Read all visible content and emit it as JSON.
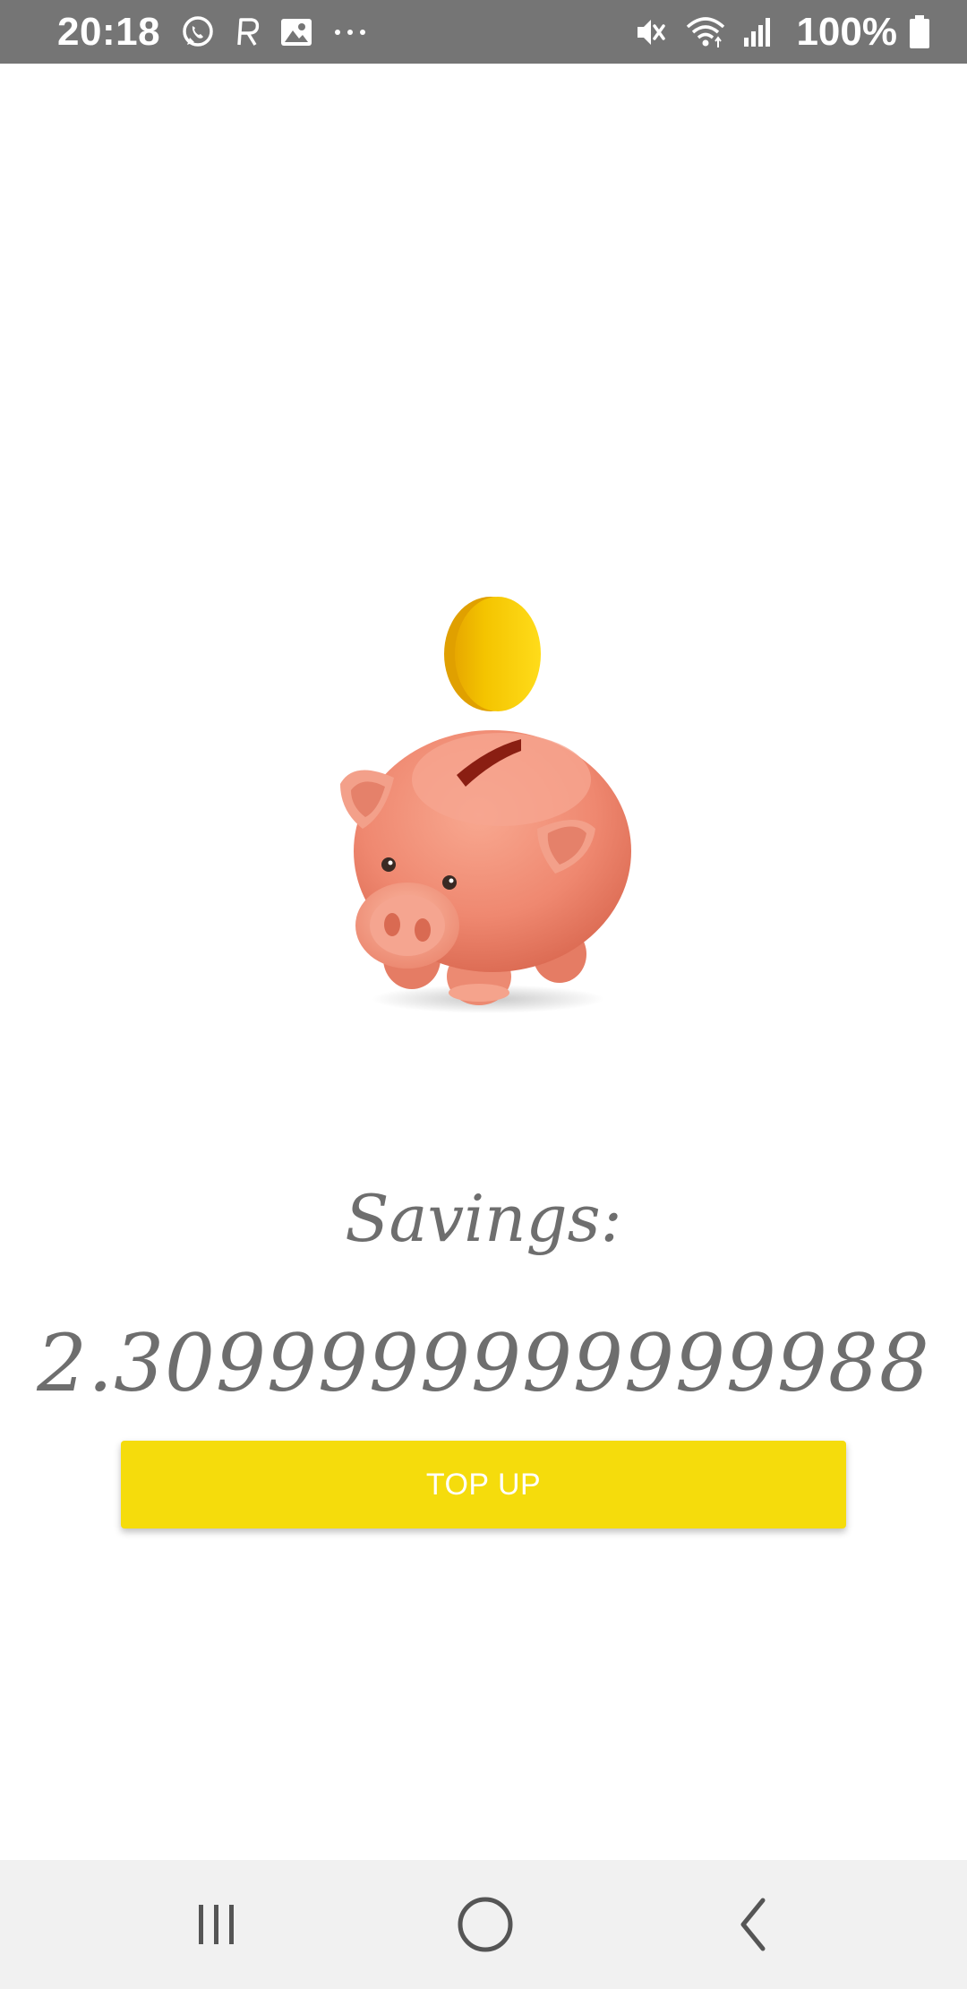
{
  "status_bar": {
    "time": "20:18",
    "battery": "100%",
    "icons": [
      "whatsapp-icon",
      "r-app-icon",
      "gallery-icon",
      "more-dots-icon",
      "mute-icon",
      "wifi-icon",
      "signal-icon",
      "battery-icon"
    ]
  },
  "main": {
    "illustration": "piggy-bank-with-coin",
    "savings_label": "Savings:",
    "savings_value": "2.3099999999999988",
    "topup_label": "TOP UP"
  },
  "nav_bar": {
    "buttons": [
      "recent-apps",
      "home",
      "back"
    ]
  },
  "colors": {
    "status_bar": "#757575",
    "accent_button": "#f5dc0c",
    "text_gray": "#6e6e6e",
    "nav_bar": "#f1f1f1"
  }
}
